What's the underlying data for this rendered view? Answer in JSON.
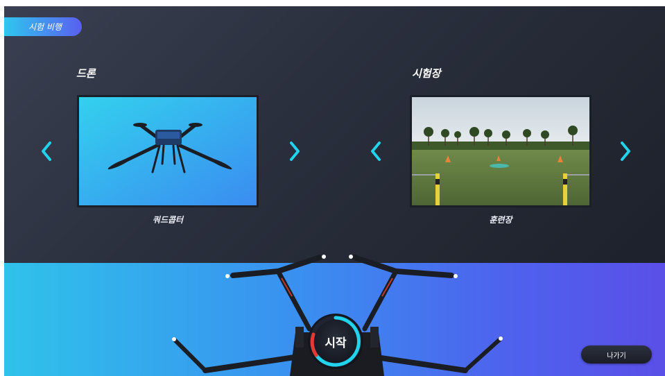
{
  "header": {
    "mode_label": "시험 비행"
  },
  "drone_section": {
    "title": "드론",
    "selected_caption": "쿼드콥터"
  },
  "field_section": {
    "title": "시험장",
    "selected_caption": "훈련장"
  },
  "controls": {
    "start_label": "시작",
    "exit_label": "나가기"
  },
  "icons": {
    "prev": "chevron-left-icon",
    "next": "chevron-right-icon"
  },
  "colors": {
    "accent_cyan": "#22d3ee",
    "ring_red": "#e53935",
    "panel_dark": "#2b303e"
  }
}
